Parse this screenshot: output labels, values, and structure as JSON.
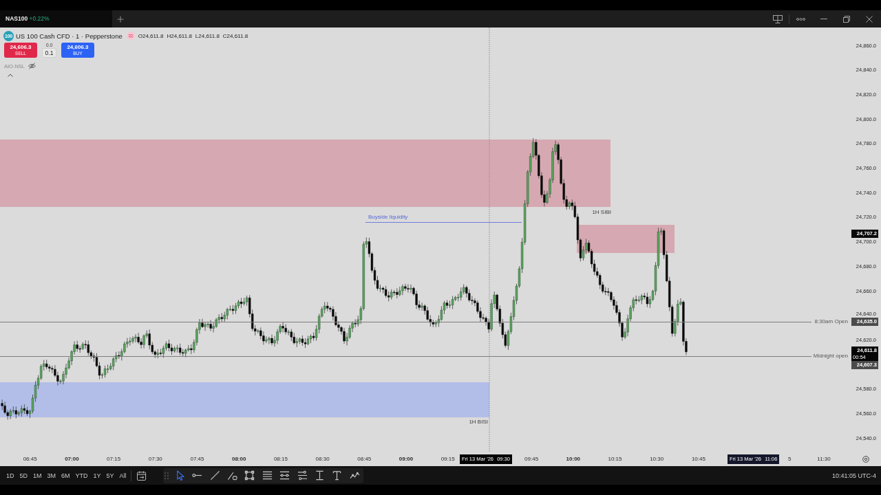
{
  "tab": {
    "symbol": "NAS100",
    "change": "+0.22%",
    "positive": true
  },
  "legend": {
    "logo_text": "100",
    "title": "US 100 Cash CFD · 1 · Pepperstone",
    "ohlc": [
      "O24,611.8",
      "H24,611.8",
      "L24,611.8",
      "C24,611.8"
    ],
    "trade": {
      "sell": {
        "price": "24,606.3",
        "label": "SELL"
      },
      "spread": "0.0",
      "quantity": "0.1",
      "buy": {
        "price": "24,606.3",
        "label": "BUY"
      }
    },
    "indicator": {
      "name": "AIO-NSL",
      "hidden": true
    }
  },
  "chart": {
    "zones": [
      {
        "label": "1H SIBI",
        "color": "#d6a9b2"
      },
      {
        "color": "#d6a9b2"
      },
      {
        "label": "1H BISI",
        "color": "#b2bee8"
      }
    ],
    "liquidity_line": {
      "label": "Buyside liquidity"
    },
    "levels": [
      {
        "label": "8:30am Open",
        "price": "24,635.0"
      },
      {
        "label": "Midnight open",
        "price": "24,607.3"
      }
    ]
  },
  "price_axis": {
    "labels": [
      "24,860.0",
      "24,840.0",
      "24,820.0",
      "24,800.0",
      "24,780.0",
      "24,760.0",
      "24,740.0",
      "24,720.0",
      "24,700.0",
      "24,680.0",
      "24,660.0",
      "24,640.0",
      "24,620.0",
      "24,580.0",
      "24,560.0",
      "24,540.0"
    ],
    "marker": "24,707.2",
    "last_price": {
      "price": "24,611.8",
      "countdown": "00:54"
    }
  },
  "time_axis": {
    "labels": [
      {
        "text": "06:45",
        "major": false
      },
      {
        "text": "07:00",
        "major": true
      },
      {
        "text": "07:15",
        "major": false
      },
      {
        "text": "07:30",
        "major": false
      },
      {
        "text": "07:45",
        "major": false
      },
      {
        "text": "08:00",
        "major": true
      },
      {
        "text": "08:15",
        "major": false
      },
      {
        "text": "08:30",
        "major": false
      },
      {
        "text": "08:45",
        "major": false
      },
      {
        "text": "09:00",
        "major": true
      },
      {
        "text": "09:15",
        "major": false
      },
      {
        "text": "09:45",
        "major": false
      },
      {
        "text": "10:00",
        "major": true
      },
      {
        "text": "10:15",
        "major": false
      },
      {
        "text": "10:30",
        "major": false
      },
      {
        "text": "10:45",
        "major": false
      },
      {
        "text": "5",
        "major": false
      },
      {
        "text": "11:30",
        "major": false
      }
    ],
    "cursor_labels": [
      {
        "date": "Fri 13 Mar '26",
        "time": "09:30",
        "kind": "crosshair"
      },
      {
        "date": "Fri 13 Mar '26",
        "time": "11:06",
        "kind": "hover"
      }
    ]
  },
  "toolbar": {
    "ranges": [
      {
        "label": "1D",
        "selected": false
      },
      {
        "label": "5D",
        "selected": false
      },
      {
        "label": "1M",
        "selected": false
      },
      {
        "label": "3M",
        "selected": false
      },
      {
        "label": "6M",
        "selected": false
      },
      {
        "label": "YTD",
        "selected": false
      },
      {
        "label": "1Y",
        "selected": false
      },
      {
        "label": "5Y",
        "selected": false
      },
      {
        "label": "All",
        "selected": false
      }
    ],
    "drawing_tools": [
      {
        "kind": "cursor",
        "selected": true
      },
      {
        "kind": "horizontal-line",
        "selected": false
      },
      {
        "kind": "trend-line",
        "selected": false
      },
      {
        "kind": "path",
        "selected": false
      },
      {
        "kind": "rectangle",
        "selected": false
      },
      {
        "kind": "fib-retracement",
        "selected": false
      },
      {
        "kind": "fib-channel",
        "selected": false
      },
      {
        "kind": "parallel-channel",
        "selected": false
      },
      {
        "kind": "measure",
        "selected": false
      },
      {
        "kind": "text",
        "selected": false
      },
      {
        "kind": "pattern",
        "selected": false
      }
    ],
    "clock": "10:41:05 UTC-4"
  }
}
